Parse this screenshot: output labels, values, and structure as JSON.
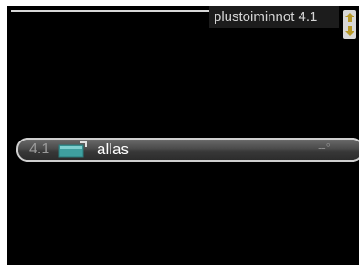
{
  "header": {
    "title": "plustoiminnot 4.1"
  },
  "menu": {
    "items": [
      {
        "number": "4.1",
        "icon": "pool-icon",
        "label": "allas",
        "value": "--°"
      }
    ]
  },
  "colors": {
    "background": "#000000",
    "row_border": "#cfcfcf",
    "icon_accent": "#3fa0a0",
    "scroll_arrow": "#b89a2a"
  }
}
